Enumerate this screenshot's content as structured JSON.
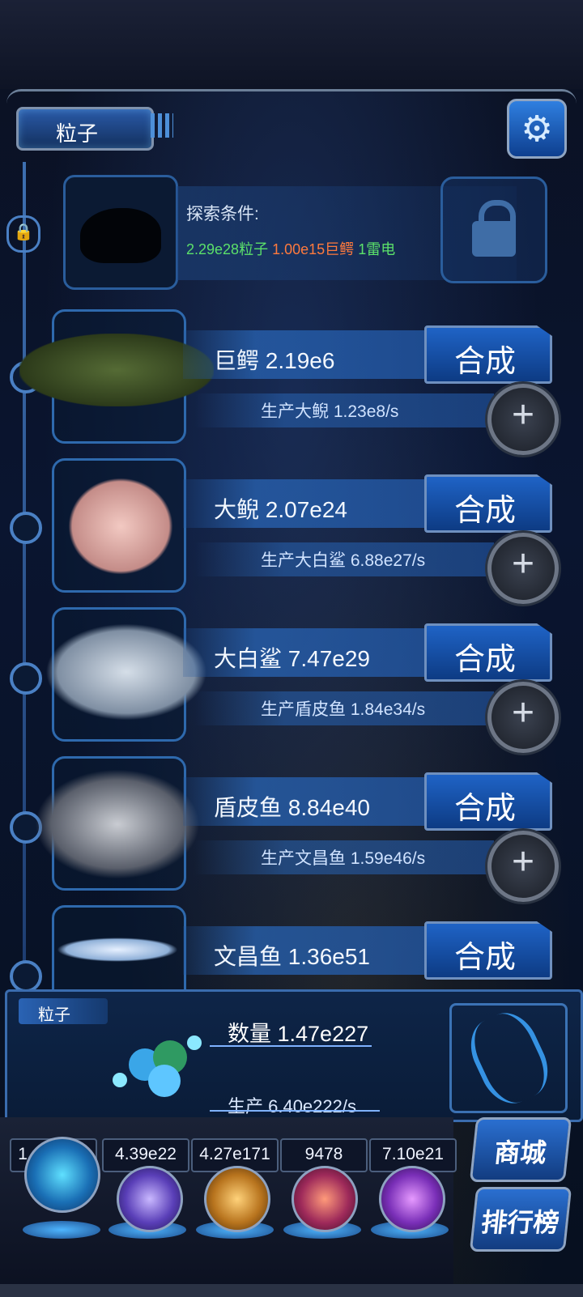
{
  "header": {
    "title": "粒子"
  },
  "explore": {
    "title": "探索条件:",
    "req_particles": "2.29e28粒子",
    "req_croc": "1.00e15巨鳄",
    "req_thunder": "1雷电"
  },
  "creatures": [
    {
      "name": "巨鳄 2.19e6",
      "production": "生产大鲵 1.23e8/s",
      "merge_label": "合成"
    },
    {
      "name": "大鲵 2.07e24",
      "production": "生产大白鲨 6.88e27/s",
      "merge_label": "合成"
    },
    {
      "name": "大白鲨 7.47e29",
      "production": "生产盾皮鱼 1.84e34/s",
      "merge_label": "合成"
    },
    {
      "name": "盾皮鱼 8.84e40",
      "production": "生产文昌鱼 1.59e46/s",
      "merge_label": "合成"
    },
    {
      "name": "文昌鱼 1.36e51",
      "production": "",
      "merge_label": "合成"
    }
  ],
  "panel": {
    "tag": "粒子",
    "quantity": "数量 1.47e227",
    "production": "生产 6.40e222/s"
  },
  "resources": [
    {
      "value": "1.47e227",
      "icon": "particle-orb"
    },
    {
      "value": "4.39e22",
      "icon": "thunder-orb"
    },
    {
      "value": "4.27e171",
      "icon": "fire-orb"
    },
    {
      "value": "9478",
      "icon": "brain-orb"
    },
    {
      "value": "7.10e21",
      "icon": "vortex-orb"
    }
  ],
  "side_buttons": {
    "shop": "商城",
    "ranking": "排行榜"
  },
  "colors": {
    "accent": "#1f63c6",
    "green": "#5be06a",
    "orange": "#ff7a3d"
  }
}
